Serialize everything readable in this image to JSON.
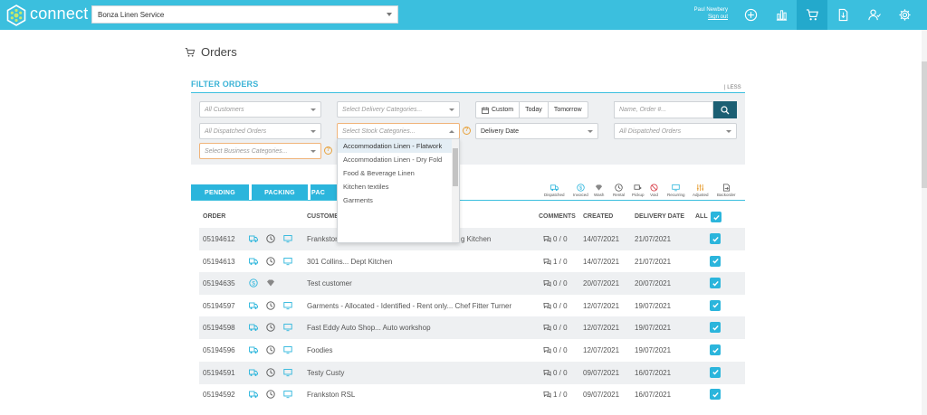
{
  "app": {
    "name": "connect",
    "company": "Bonza Linen Service"
  },
  "user": {
    "name": "Paul Newbery",
    "signout": "Sign out"
  },
  "nav": {
    "icons": [
      "plus-circle-icon",
      "bar-chart-icon",
      "cart-icon",
      "document-icon",
      "users-icon",
      "gear-icon"
    ],
    "active": "cart-icon"
  },
  "page": {
    "title": "Orders"
  },
  "filter": {
    "title": "FILTER ORDERS",
    "less": "| LESS",
    "customers": "All Customers",
    "delivery_categories": "Select Delivery Categories...",
    "stock_categories": "Select Stock Categories...",
    "dispatched_left": "All Dispatched Orders",
    "business_categories": "Select Business Categories...",
    "delivery_date": "Delivery Date",
    "dispatched_right": "All Dispatched Orders",
    "custom": "Custom",
    "today": "Today",
    "tomorrow": "Tomorrow",
    "search_placeholder": "Name, Order #..."
  },
  "stock_dropdown": {
    "options": [
      "Accommodation Linen - Flatwork",
      "Accommodation Linen - Dry Fold",
      "Food & Beverage Linen",
      "Kitchen textiles",
      "Garments"
    ],
    "highlighted": "Accommodation Linen - Flatwork"
  },
  "tabs": [
    "PENDING",
    "PACKING",
    "PAC"
  ],
  "legend": [
    "Dispatched",
    "Invoiced",
    "Wash",
    "Rental",
    "Pickup",
    "Void",
    "Recurring",
    "Adjusted",
    "Backorder"
  ],
  "table": {
    "headers": {
      "order": "ORDER",
      "customer": "CUSTOMER",
      "comments": "COMMENTS",
      "created": "CREATED",
      "delivery": "DELIVERY DATE",
      "all": "ALL"
    },
    "rows": [
      {
        "order": "05194612",
        "icons": [
          "truck",
          "clock",
          "screen"
        ],
        "customer": "Frankston",
        "customer_tail": "g Kitchen",
        "comments": "0 / 0",
        "created": "14/07/2021",
        "delivery": "21/07/2021"
      },
      {
        "order": "05194613",
        "icons": [
          "truck",
          "clock",
          "screen"
        ],
        "customer": "301 Collins... Dept Kitchen",
        "comments": "1 / 0",
        "created": "14/07/2021",
        "delivery": "21/07/2021"
      },
      {
        "order": "05194635",
        "icons": [
          "dollar",
          "diamond"
        ],
        "customer": "Test customer",
        "comments": "0 / 0",
        "created": "20/07/2021",
        "delivery": "20/07/2021"
      },
      {
        "order": "05194597",
        "icons": [
          "truck",
          "clock",
          "screen"
        ],
        "customer": "Garments - Allocated - Identified - Rent only... Chef Fitter Turner",
        "comments": "0 / 0",
        "created": "12/07/2021",
        "delivery": "19/07/2021"
      },
      {
        "order": "05194598",
        "icons": [
          "truck",
          "clock",
          "screen"
        ],
        "customer": "Fast Eddy Auto Shop... Auto workshop",
        "comments": "0 / 0",
        "created": "12/07/2021",
        "delivery": "19/07/2021"
      },
      {
        "order": "05194596",
        "icons": [
          "truck",
          "clock",
          "screen"
        ],
        "customer": "Foodies",
        "comments": "0 / 0",
        "created": "12/07/2021",
        "delivery": "19/07/2021"
      },
      {
        "order": "05194591",
        "icons": [
          "truck",
          "clock",
          "screen"
        ],
        "customer": "Testy Custy",
        "comments": "0 / 0",
        "created": "09/07/2021",
        "delivery": "16/07/2021"
      },
      {
        "order": "05194592",
        "icons": [
          "truck",
          "clock",
          "screen"
        ],
        "customer": "Frankston RSL",
        "comments": "1 / 0",
        "created": "09/07/2021",
        "delivery": "16/07/2021"
      }
    ]
  },
  "colors": {
    "topbar": "#3bbfde",
    "accent": "#2bb5dc",
    "search_button": "#1c5f73",
    "warning": "#e8a23b"
  }
}
